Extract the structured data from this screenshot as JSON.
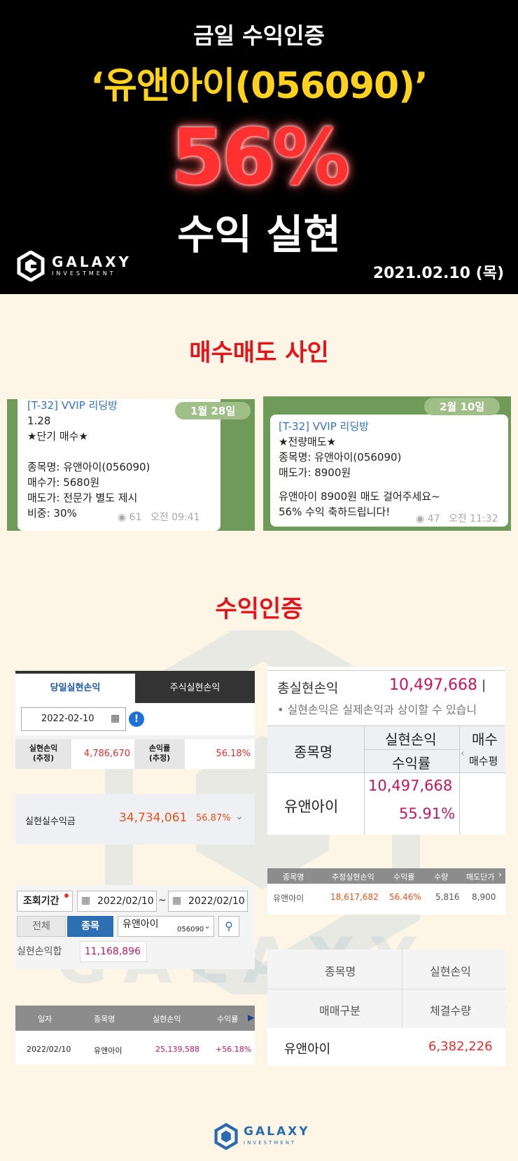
{
  "header": {
    "line1": "금일 수익인증",
    "line2": "‘유앤아이(056090)’",
    "percent": "56%",
    "line4": "수익 실현",
    "logo_word": "GALAXY",
    "logo_sub": "INVESTMENT",
    "date": "2021.02.10 (목)"
  },
  "section1": {
    "title": "매수매도 사인"
  },
  "chat_left": {
    "date": "1월 28일",
    "room": "[T-32] VVIP 리딩방",
    "lines": [
      "1.28",
      "★단기 매수★",
      "",
      "종목명: 유앤아이(056090)",
      "매수가: 5680원",
      "매도가: 전문가 별도 제시",
      "비중: 30%"
    ],
    "views": "61",
    "time": "오전 09:41"
  },
  "chat_right": {
    "date": "2월 10일",
    "room": "[T-32] VVIP 리딩방",
    "lines": [
      "★전량매도★",
      "종목명: 유앤아이(056090)",
      "매도가: 8900원",
      "",
      "유앤아이 8900원 매도 걸어주세요~",
      "56% 수익 축하드립니다!"
    ],
    "views": "47",
    "time": "오전 11:32"
  },
  "section2": {
    "title": "수익인증"
  },
  "card1": {
    "tab_active": "당일실현손익",
    "tab_inactive": "주식실현손익",
    "date": "2022-02-10",
    "col1_label": "실현손익\n(추정)",
    "col1_value": "4,786,670",
    "col2_label": "손익률\n(추정)",
    "col2_value": "56.18%"
  },
  "card2": {
    "label": "실현실수익금",
    "value": "34,734,061",
    "rate": "56.87%"
  },
  "card3": {
    "period_label": "조회기간",
    "date_from": "2022/02/10",
    "date_to": "2022/02/10",
    "sep": "~",
    "btn_all": "전체",
    "btn_stock": "종목",
    "stock_name": "유앤아이",
    "stock_code": "056090",
    "sum_label": "실현손익합",
    "sum_value": "11,168,896"
  },
  "card4": {
    "headers": [
      "일자",
      "종목명",
      "실현손익",
      "수익률"
    ],
    "row": [
      "2022/02/10",
      "유앤아이",
      "25,139,588",
      "+56.18%"
    ]
  },
  "card5": {
    "total_label": "총실현손익",
    "total_value": "10,497,668",
    "note": "• 실현손익은 실제손익과 상이할 수 있습니",
    "h_name": "종목명",
    "h_pl": "실현손익",
    "h_rate": "수익률",
    "h_buy": "매수",
    "h_buyavg": "매수평",
    "name": "유앤아이",
    "pl": "10,497,668",
    "rate": "55.91%"
  },
  "card6": {
    "headers": [
      "종목명",
      "추정실현손익",
      "수익률",
      "수량",
      "매도단가"
    ],
    "row": [
      "유앤아이",
      "18,617,682",
      "56.46%",
      "5,816",
      "8,900"
    ]
  },
  "card7": {
    "h1": "종목명",
    "h2": "실현손익",
    "h3": "매매구분",
    "h4": "체결수량",
    "name": "유앤아이",
    "value": "6,382,226"
  },
  "footer": {
    "logo_word": "GALAXY",
    "logo_sub": "INVESTMENT"
  }
}
